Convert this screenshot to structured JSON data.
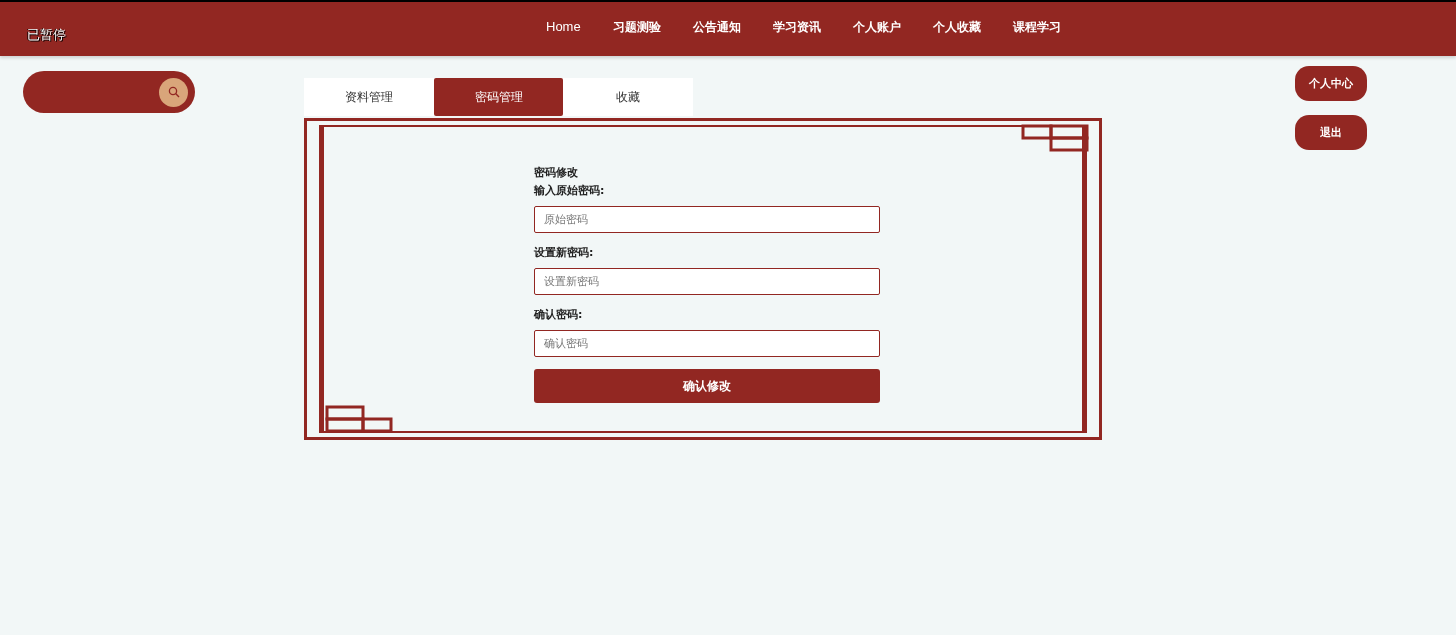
{
  "header": {
    "status_text": "已暂停",
    "nav": [
      {
        "label": "Home"
      },
      {
        "label": "习题测验"
      },
      {
        "label": "公告通知"
      },
      {
        "label": "学习资讯"
      },
      {
        "label": "个人账户"
      },
      {
        "label": "个人收藏"
      },
      {
        "label": "课程学习"
      }
    ]
  },
  "tabs": [
    {
      "label": "资料管理",
      "selected": false
    },
    {
      "label": "密码管理",
      "selected": true
    },
    {
      "label": "收藏",
      "selected": false
    }
  ],
  "form": {
    "title": "密码修改",
    "fields": [
      {
        "label": "输入原始密码:",
        "placeholder": "原始密码"
      },
      {
        "label": "设置新密码:",
        "placeholder": "设置新密码"
      },
      {
        "label": "确认密码:",
        "placeholder": "确认密码"
      }
    ],
    "submit": "确认修改"
  },
  "side_buttons": [
    "个人中心",
    "退出"
  ]
}
